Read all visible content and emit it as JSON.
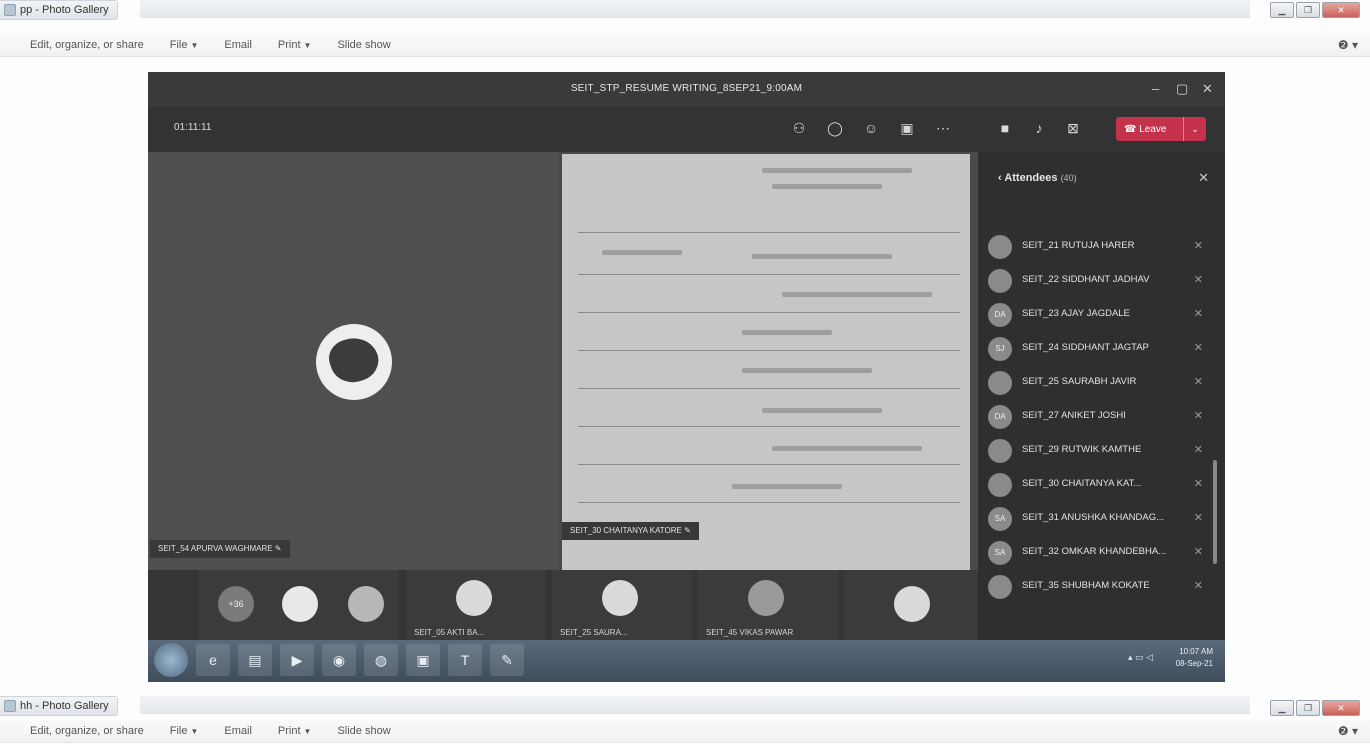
{
  "window1": {
    "title": "pp - Photo Gallery",
    "menu": [
      "Edit, organize, or share",
      "File",
      "Email",
      "Print",
      "Slide show"
    ],
    "help": "?"
  },
  "window2": {
    "title": "hh - Photo Gallery",
    "menu": [
      "Edit, organize, or share",
      "File",
      "Email",
      "Print",
      "Slide show"
    ],
    "help": "?"
  },
  "teams": {
    "meeting_title": "SEIT_STP_RESUME WRITING_8SEP21_9:00AM",
    "timer": "01:11:11",
    "leave_label": "Leave",
    "toolbar_icons": [
      "people-icon",
      "chat-icon",
      "react-icon",
      "rooms-icon",
      "more-icon",
      "camera-icon",
      "mic-icon",
      "share-icon"
    ],
    "pinned": {
      "name": "SEIT_54 APURVA WAGHMARE"
    },
    "doc_share": {
      "name": "SEIT_30 CHAITANYA KATORE"
    },
    "strip": [
      {
        "count": "+36"
      },
      {
        "name": "SEIT_05 AKTI BA..."
      },
      {
        "name": "SEIT_25 SAURA..."
      },
      {
        "name": "SEIT_45 VIKAS PAWAR"
      }
    ],
    "attendees": {
      "header": "Attendees",
      "count": "(40)",
      "list": [
        {
          "name": "SEIT_21 RUTUJA HARER",
          "initials": ""
        },
        {
          "name": "SEIT_22 SIDDHANT JADHAV",
          "initials": ""
        },
        {
          "name": "SEIT_23 AJAY JAGDALE",
          "initials": "DA"
        },
        {
          "name": "SEIT_24 SIDDHANT JAGTAP",
          "initials": "SJ"
        },
        {
          "name": "SEIT_25 SAURABH JAVIR",
          "initials": ""
        },
        {
          "name": "SEIT_27 ANIKET JOSHI",
          "initials": "DA"
        },
        {
          "name": "SEIT_29 RUTWIK KAMTHE",
          "initials": ""
        },
        {
          "name": "SEIT_30 CHAITANYA KAT...",
          "initials": ""
        },
        {
          "name": "SEIT_31 ANUSHKA KHANDAG...",
          "initials": "SA"
        },
        {
          "name": "SEIT_32 OMKAR KHANDEBHA...",
          "initials": "SA"
        },
        {
          "name": "SEIT_35 SHUBHAM KOKATE",
          "initials": ""
        }
      ]
    },
    "taskbar": {
      "time": "10:07 AM",
      "date": "08-Sep-21"
    }
  }
}
